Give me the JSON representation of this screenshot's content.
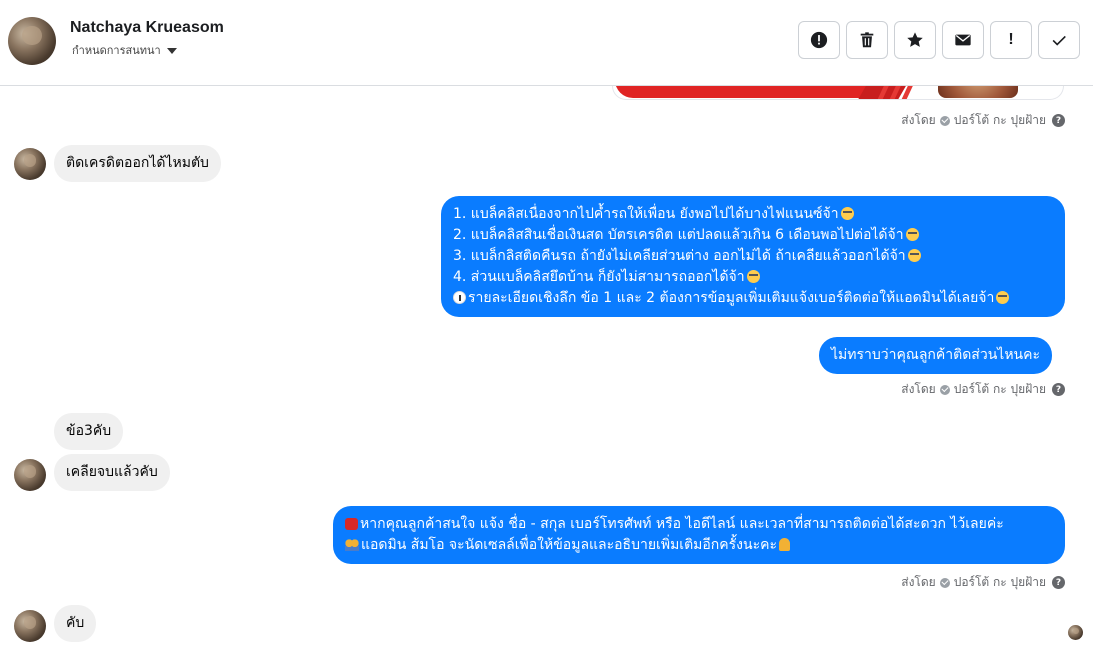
{
  "header": {
    "contact_name": "Natchaya Krueasom",
    "assign_label": "กำหนดการสนทนา",
    "actions": [
      {
        "name": "spam-button",
        "icon": "alert-circle-icon"
      },
      {
        "name": "delete-button",
        "icon": "trash-icon"
      },
      {
        "name": "star-button",
        "icon": "star-icon"
      },
      {
        "name": "mark-unread-button",
        "icon": "envelope-icon"
      },
      {
        "name": "follow-up-button",
        "icon": "exclamation-icon",
        "label": "!"
      },
      {
        "name": "mark-done-button",
        "icon": "check-icon"
      }
    ]
  },
  "meta": {
    "sent_by": "ส่งโดย",
    "sender": "ปอร์โต้ กะ ปุยฝ้าย",
    "help": "?"
  },
  "messages": [
    {
      "id": "m1",
      "direction": "incoming",
      "text": "ติดเครดิตออกได้ไหมตับ"
    },
    {
      "id": "m2",
      "direction": "outgoing",
      "lines": [
        "1. แบล็คลิสเนื่องจากไปค้ำรถให้เพื่อน ยังพอไปได้บางไฟแนนซ์จ้า",
        "2. แบล็คลิสสินเชื่อเงินสด บัตรเครดิต แต่ปลดแล้วเกิน 6 เดือนพอไปต่อได้จ้า",
        "3. แบล็กลิสติดคืนรถ ถ้ายังไม่เคลียส่วนต่าง ออกไม่ได้ ถ้าเคลียแล้วออกได้จ้า",
        "4. ส่วนแบล็คลิสยึดบ้าน ก็ยังไม่สามารถออกได้จ้า",
        "รายละเอียดเชิงลึก ข้อ 1 และ 2 ต้องการข้อมูลเพิ่มเติมแจ้งเบอร์ติดต่อให้แอดมินได้เลยจ้า"
      ]
    },
    {
      "id": "m3",
      "direction": "outgoing",
      "text": "ไม่ทราบว่าคุณลูกค้าติดส่วนไหนคะ"
    },
    {
      "id": "m4",
      "direction": "incoming",
      "text": "ข้อ3คับ"
    },
    {
      "id": "m5",
      "direction": "incoming",
      "text": "เคลียจบแล้วคับ"
    },
    {
      "id": "m6",
      "direction": "outgoing",
      "lines": [
        "หากคุณลูกค้าสนใจ แจ้ง ชื่อ - สกุล เบอร์โทรศัพท์ หรือ ไอดีไลน์ และเวลาที่สามารถติดต่อได้สะดวก ไว้เลยค่ะ",
        "แอดมิน ส้มโอ จะนัดเซลล์เพื่อให้ข้อมูลและอธิบายเพิ่มเติมอีกครั้งนะคะ"
      ]
    },
    {
      "id": "m7",
      "direction": "incoming",
      "text": "คับ"
    }
  ],
  "colors": {
    "outgoing_bubble": "#0a7cff",
    "incoming_bubble": "#f0f0f0",
    "meta_text": "#65676b",
    "border": "#dadde1"
  }
}
